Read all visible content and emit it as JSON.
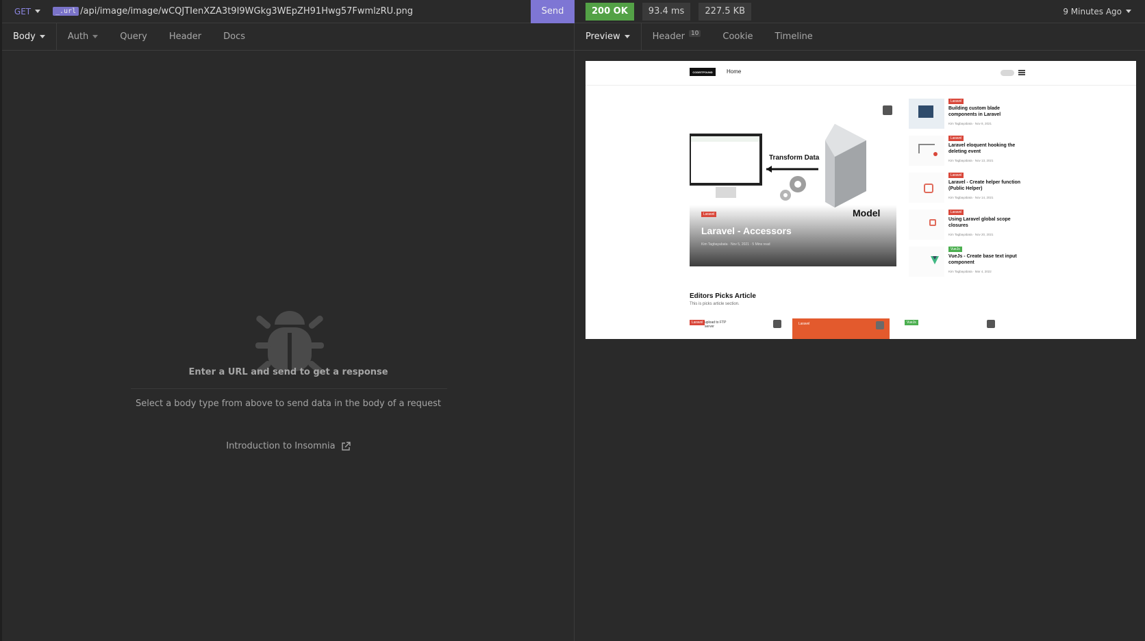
{
  "request": {
    "method": "GET",
    "url_var": "_.url",
    "url_path": "/api/image/image/wCQJTIenXZA3t9I9WGkg3WEpZH91Hwg57FwmlzRU.png",
    "send_label": "Send"
  },
  "request_tabs": [
    {
      "label": "Body",
      "active": true
    },
    {
      "label": "Auth"
    },
    {
      "label": "Query"
    },
    {
      "label": "Header"
    },
    {
      "label": "Docs"
    }
  ],
  "empty_state": {
    "title": "Enter a URL and send to get a response",
    "subtitle": "Select a body type from above to send data in the body of a request",
    "link": "Introduction to Insomnia",
    "icon": "bug-icon"
  },
  "response": {
    "status": "200 OK",
    "time": "93.4 ms",
    "size": "227.5 KB",
    "ago": "9 Minutes Ago",
    "status_color": "#53a146"
  },
  "response_tabs": [
    {
      "label": "Preview",
      "active": true
    },
    {
      "label": "Header",
      "badge": "10"
    },
    {
      "label": "Cookie"
    },
    {
      "label": "Timeline"
    }
  ],
  "preview": {
    "logo": "CODEITFOUND",
    "nav_home": "Home",
    "hero": {
      "tag": "Laravel",
      "title": "Laravel - Accessors",
      "meta": "Kim Tagbayabata · Nov 5, 2021 · 5 Mins read",
      "art_label_1": "Transform Data",
      "art_label_2": "Model"
    },
    "side_posts": [
      {
        "tag": "Laravel",
        "title": "Building custom blade components in Laravel",
        "meta": "Kim Tagbayabata · Nov 8, 2021"
      },
      {
        "tag": "Laravel",
        "title": "Laravel eloquent hooking the deleting event",
        "meta": "Kim Tagbayabata · Nov 13, 2021"
      },
      {
        "tag": "Laravel",
        "title": "Laravel - Create helper function (Public Helper)",
        "meta": "Kim Tagbayabata · Nov 14, 2021"
      },
      {
        "tag": "Laravel",
        "title": "Using Laravel global scope closures",
        "meta": "Kim Tagbayabata · Nov 20, 2021"
      },
      {
        "tag": "VueJs",
        "title": "VueJs - Create base text input component",
        "meta": "Kim Tagbayabata · Mar 4, 2022"
      }
    ],
    "picks_title": "Editors Picks Article",
    "picks_sub": "This is picks article section.",
    "pick_cards": [
      {
        "tag": "Laravel",
        "text": "upload to FTP server"
      },
      {
        "tag": "Laravel"
      },
      {
        "tag": "VueJs"
      }
    ]
  }
}
